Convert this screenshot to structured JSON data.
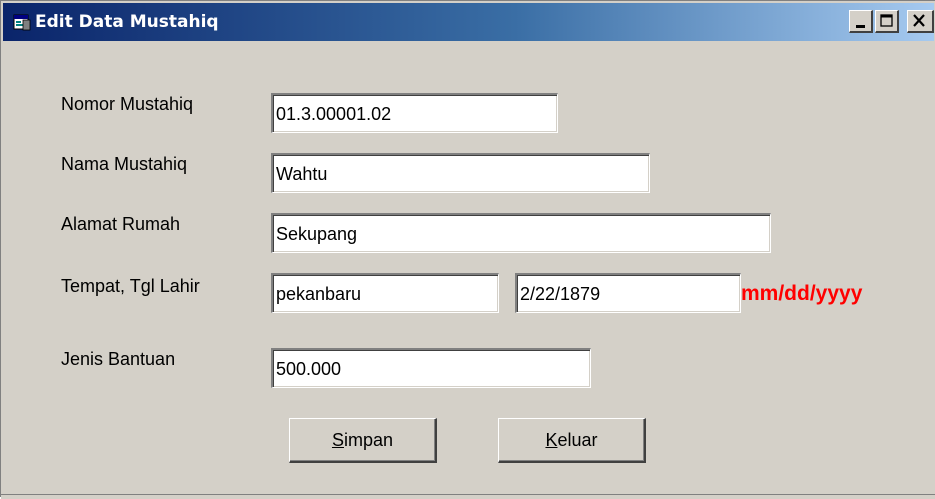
{
  "window": {
    "title": "Edit Data Mustahiq",
    "icon": "form-app-icon",
    "controls": [
      "minimize-icon",
      "maximize-icon",
      "close-icon"
    ]
  },
  "form": {
    "fields": [
      {
        "label": "Nomor Mustahiq",
        "value": "01.3.00001.02"
      },
      {
        "label": "Nama Mustahiq",
        "value": "Wahtu"
      },
      {
        "label": "Alamat Rumah",
        "value": "Sekupang"
      },
      {
        "label": "Tempat, Tgl Lahir",
        "value": "pekanbaru",
        "value2": "2/22/1879"
      },
      {
        "label": "Jenis Bantuan",
        "value": "500.000"
      }
    ],
    "date_hint": "mm/dd/yyyy",
    "date_hint_color": "#ff0000"
  },
  "buttons": {
    "save": {
      "accel": "S",
      "rest": "impan"
    },
    "exit": {
      "accel": "K",
      "rest": "eluar"
    }
  },
  "colors": {
    "titlebar_start": "#0a246a",
    "titlebar_end": "#a6caf0",
    "face": "#d4d0c8"
  }
}
